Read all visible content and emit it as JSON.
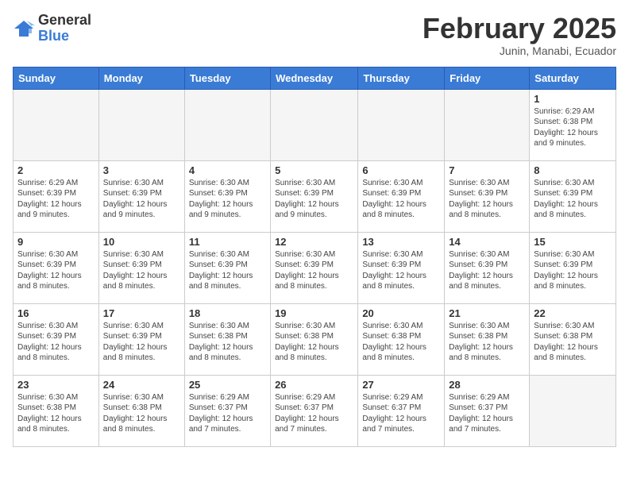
{
  "logo": {
    "general": "General",
    "blue": "Blue"
  },
  "header": {
    "month": "February 2025",
    "location": "Junin, Manabi, Ecuador"
  },
  "weekdays": [
    "Sunday",
    "Monday",
    "Tuesday",
    "Wednesday",
    "Thursday",
    "Friday",
    "Saturday"
  ],
  "weeks": [
    [
      {
        "day": "",
        "info": ""
      },
      {
        "day": "",
        "info": ""
      },
      {
        "day": "",
        "info": ""
      },
      {
        "day": "",
        "info": ""
      },
      {
        "day": "",
        "info": ""
      },
      {
        "day": "",
        "info": ""
      },
      {
        "day": "1",
        "info": "Sunrise: 6:29 AM\nSunset: 6:38 PM\nDaylight: 12 hours\nand 9 minutes."
      }
    ],
    [
      {
        "day": "2",
        "info": "Sunrise: 6:29 AM\nSunset: 6:39 PM\nDaylight: 12 hours\nand 9 minutes."
      },
      {
        "day": "3",
        "info": "Sunrise: 6:30 AM\nSunset: 6:39 PM\nDaylight: 12 hours\nand 9 minutes."
      },
      {
        "day": "4",
        "info": "Sunrise: 6:30 AM\nSunset: 6:39 PM\nDaylight: 12 hours\nand 9 minutes."
      },
      {
        "day": "5",
        "info": "Sunrise: 6:30 AM\nSunset: 6:39 PM\nDaylight: 12 hours\nand 9 minutes."
      },
      {
        "day": "6",
        "info": "Sunrise: 6:30 AM\nSunset: 6:39 PM\nDaylight: 12 hours\nand 8 minutes."
      },
      {
        "day": "7",
        "info": "Sunrise: 6:30 AM\nSunset: 6:39 PM\nDaylight: 12 hours\nand 8 minutes."
      },
      {
        "day": "8",
        "info": "Sunrise: 6:30 AM\nSunset: 6:39 PM\nDaylight: 12 hours\nand 8 minutes."
      }
    ],
    [
      {
        "day": "9",
        "info": "Sunrise: 6:30 AM\nSunset: 6:39 PM\nDaylight: 12 hours\nand 8 minutes."
      },
      {
        "day": "10",
        "info": "Sunrise: 6:30 AM\nSunset: 6:39 PM\nDaylight: 12 hours\nand 8 minutes."
      },
      {
        "day": "11",
        "info": "Sunrise: 6:30 AM\nSunset: 6:39 PM\nDaylight: 12 hours\nand 8 minutes."
      },
      {
        "day": "12",
        "info": "Sunrise: 6:30 AM\nSunset: 6:39 PM\nDaylight: 12 hours\nand 8 minutes."
      },
      {
        "day": "13",
        "info": "Sunrise: 6:30 AM\nSunset: 6:39 PM\nDaylight: 12 hours\nand 8 minutes."
      },
      {
        "day": "14",
        "info": "Sunrise: 6:30 AM\nSunset: 6:39 PM\nDaylight: 12 hours\nand 8 minutes."
      },
      {
        "day": "15",
        "info": "Sunrise: 6:30 AM\nSunset: 6:39 PM\nDaylight: 12 hours\nand 8 minutes."
      }
    ],
    [
      {
        "day": "16",
        "info": "Sunrise: 6:30 AM\nSunset: 6:39 PM\nDaylight: 12 hours\nand 8 minutes."
      },
      {
        "day": "17",
        "info": "Sunrise: 6:30 AM\nSunset: 6:39 PM\nDaylight: 12 hours\nand 8 minutes."
      },
      {
        "day": "18",
        "info": "Sunrise: 6:30 AM\nSunset: 6:38 PM\nDaylight: 12 hours\nand 8 minutes."
      },
      {
        "day": "19",
        "info": "Sunrise: 6:30 AM\nSunset: 6:38 PM\nDaylight: 12 hours\nand 8 minutes."
      },
      {
        "day": "20",
        "info": "Sunrise: 6:30 AM\nSunset: 6:38 PM\nDaylight: 12 hours\nand 8 minutes."
      },
      {
        "day": "21",
        "info": "Sunrise: 6:30 AM\nSunset: 6:38 PM\nDaylight: 12 hours\nand 8 minutes."
      },
      {
        "day": "22",
        "info": "Sunrise: 6:30 AM\nSunset: 6:38 PM\nDaylight: 12 hours\nand 8 minutes."
      }
    ],
    [
      {
        "day": "23",
        "info": "Sunrise: 6:30 AM\nSunset: 6:38 PM\nDaylight: 12 hours\nand 8 minutes."
      },
      {
        "day": "24",
        "info": "Sunrise: 6:30 AM\nSunset: 6:38 PM\nDaylight: 12 hours\nand 8 minutes."
      },
      {
        "day": "25",
        "info": "Sunrise: 6:29 AM\nSunset: 6:37 PM\nDaylight: 12 hours\nand 7 minutes."
      },
      {
        "day": "26",
        "info": "Sunrise: 6:29 AM\nSunset: 6:37 PM\nDaylight: 12 hours\nand 7 minutes."
      },
      {
        "day": "27",
        "info": "Sunrise: 6:29 AM\nSunset: 6:37 PM\nDaylight: 12 hours\nand 7 minutes."
      },
      {
        "day": "28",
        "info": "Sunrise: 6:29 AM\nSunset: 6:37 PM\nDaylight: 12 hours\nand 7 minutes."
      },
      {
        "day": "",
        "info": ""
      }
    ]
  ]
}
